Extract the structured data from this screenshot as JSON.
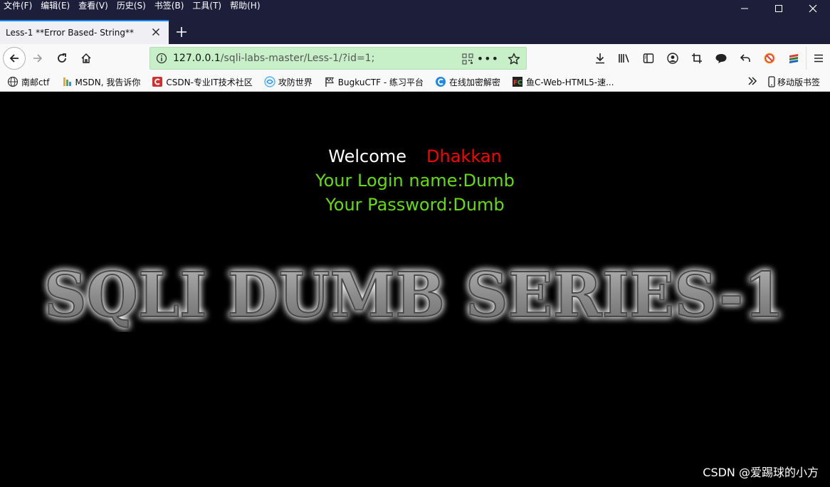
{
  "menu": [
    "文件(F)",
    "编辑(E)",
    "查看(V)",
    "历史(S)",
    "书签(B)",
    "工具(T)",
    "帮助(H)"
  ],
  "tab": {
    "title": "Less-1 **Error Based- String**"
  },
  "url": {
    "host": "127.0.0.1",
    "path": "/sqli-labs-master/Less-1/?id=1;"
  },
  "bookmarks": {
    "items": [
      {
        "label": "南邮ctf",
        "icon": "globe-icon"
      },
      {
        "label": "MSDN, 我告诉你",
        "icon": "msdn-icon"
      },
      {
        "label": "CSDN-专业IT技术社区",
        "icon": "csdn-icon"
      },
      {
        "label": "攻防世界",
        "icon": "adworld-icon"
      },
      {
        "label": "BugkuCTF - 练习平台",
        "icon": "flag-icon"
      },
      {
        "label": "在线加密解密",
        "icon": "crypto-icon"
      },
      {
        "label": "鱼C-Web-HTML5-速...",
        "icon": "fishc-icon"
      }
    ],
    "mobile": "移动版书签"
  },
  "content": {
    "welcome": "Welcome",
    "user": "Dhakkan",
    "login_line": "Your Login name:Dumb",
    "password_line": "Your Password:Dumb",
    "banner": "SQLI DUMB SERIES-1"
  },
  "watermark": "CSDN @爱踢球的小方",
  "colors": {
    "titlebar": "#1d1f3a",
    "urlbar": "#c8f0c8",
    "welcome": "#ffffff",
    "user": "#ff0000",
    "info": "#66dd00"
  }
}
